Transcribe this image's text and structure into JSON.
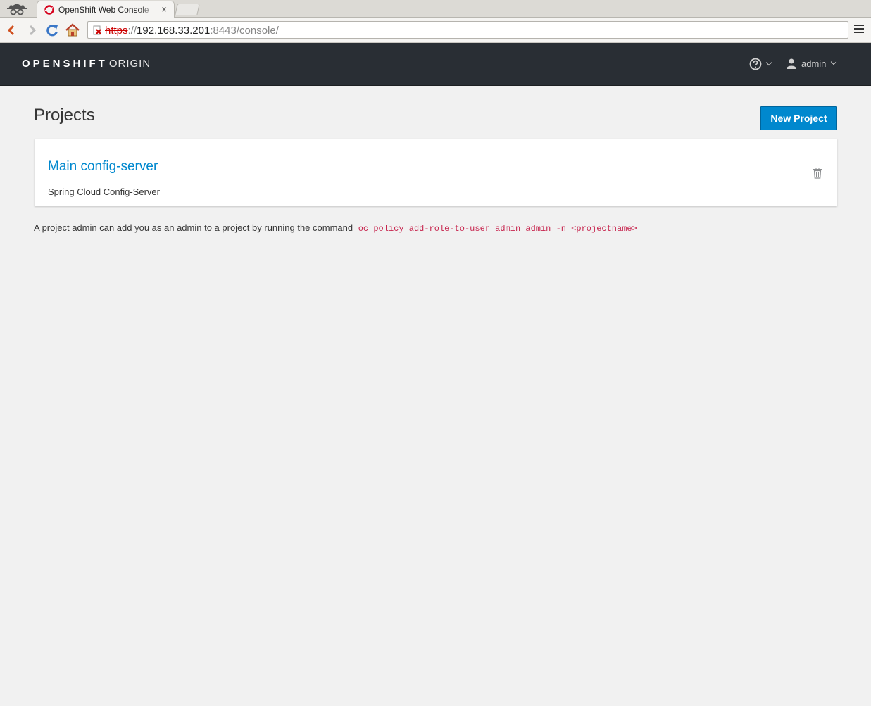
{
  "browser": {
    "tab_title": "OpenShift Web Console",
    "tab_close": "×",
    "url_scheme": "https",
    "url_sep": "://",
    "url_host": "192.168.33.201",
    "url_rest": ":8443/console/"
  },
  "header": {
    "brand_bold": "OPENSHIFT",
    "brand_light": "ORIGIN",
    "user_name": "admin"
  },
  "main": {
    "title": "Projects",
    "new_project_label": "New Project",
    "projects": [
      {
        "name": "Main config-server",
        "description": "Spring Cloud Config-Server"
      }
    ],
    "hint_text": "A project admin can add you as an admin to a project by running the command",
    "hint_command": "oc policy add-role-to-user admin admin -n <projectname>"
  },
  "colors": {
    "header_bg": "#292e34",
    "primary": "#0088ce",
    "command": "#c7254e",
    "page_bg": "#f1f1f1"
  }
}
